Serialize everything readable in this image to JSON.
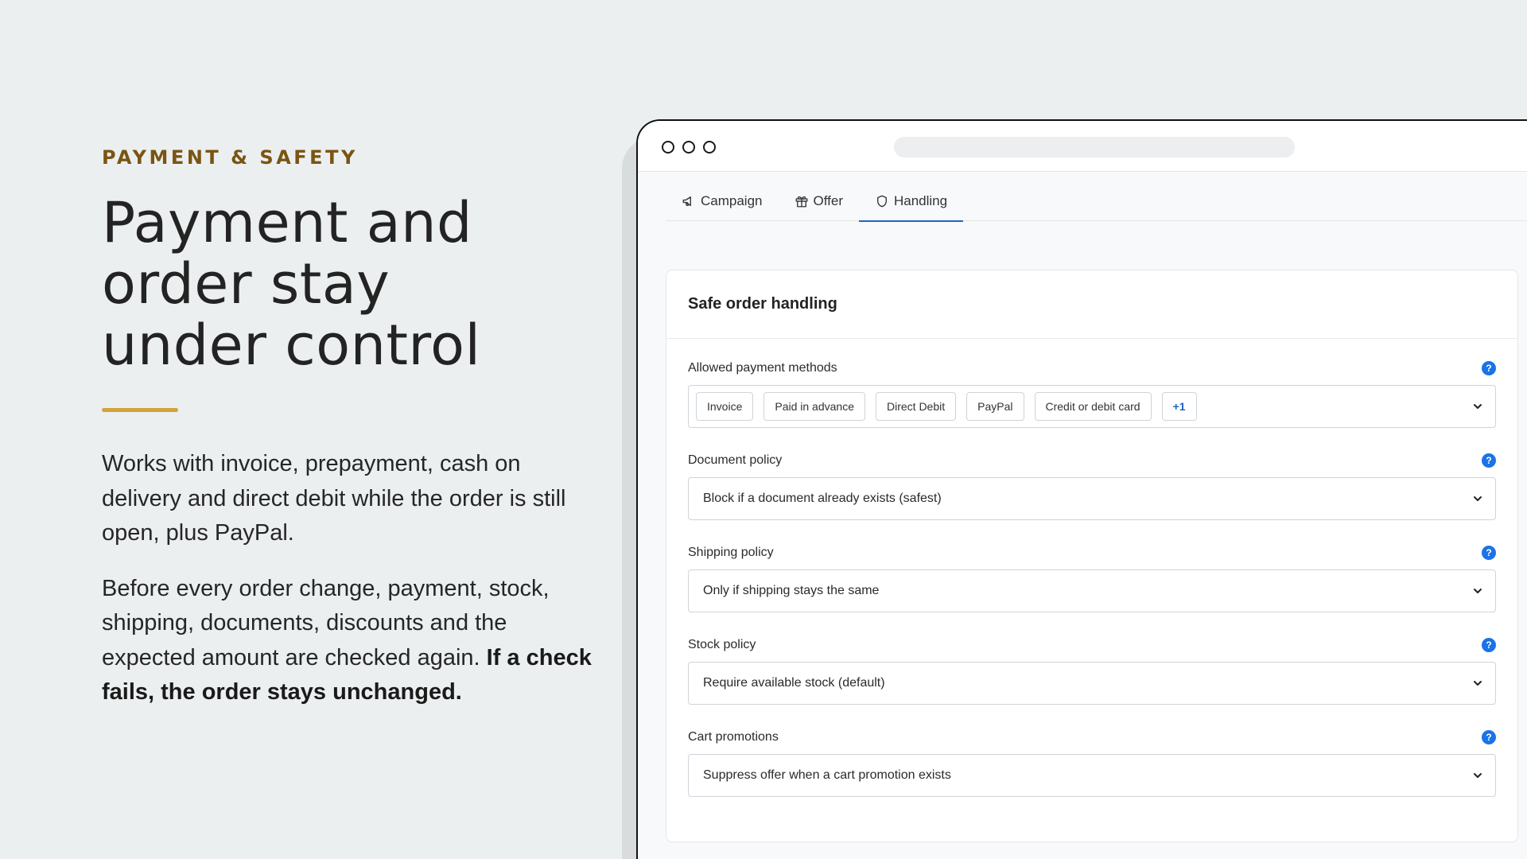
{
  "hero": {
    "eyebrow": "PAYMENT & SAFETY",
    "headline_lines": [
      "Payment and",
      "order stay",
      "under control"
    ],
    "paragraph1": "Works with invoice, prepayment, cash on delivery and direct debit while the order is still open, plus PayPal.",
    "paragraph2_plain": "Before every order change, payment, stock, shipping, documents, discounts and the expected amount are checked again. ",
    "paragraph2_bold": "If a check fails, the order stays unchanged."
  },
  "tabs": [
    {
      "label": "Campaign",
      "icon": "megaphone-icon"
    },
    {
      "label": "Offer",
      "icon": "gift-icon"
    },
    {
      "label": "Handling",
      "icon": "shield-icon",
      "active": true
    }
  ],
  "card": {
    "title": "Safe order handling",
    "help_glyph": "?",
    "payment_methods": {
      "label": "Allowed payment methods",
      "chips": [
        "Invoice",
        "Paid in advance",
        "Direct Debit",
        "PayPal",
        "Credit or debit card"
      ],
      "more": "+1"
    },
    "document_policy": {
      "label": "Document policy",
      "value": "Block if a document already exists (safest)"
    },
    "shipping_policy": {
      "label": "Shipping policy",
      "value": "Only if shipping stays the same"
    },
    "stock_policy": {
      "label": "Stock policy",
      "value": "Require available stock (default)"
    },
    "cart_promotions": {
      "label": "Cart promotions",
      "value": "Suppress offer when a cart promotion exists"
    }
  },
  "colors": {
    "background": "#eceff0",
    "eyebrow": "#7a5412",
    "accent_rule": "#d4a23a",
    "tab_active": "#1f63c4",
    "help_badge": "#1a73e8"
  }
}
